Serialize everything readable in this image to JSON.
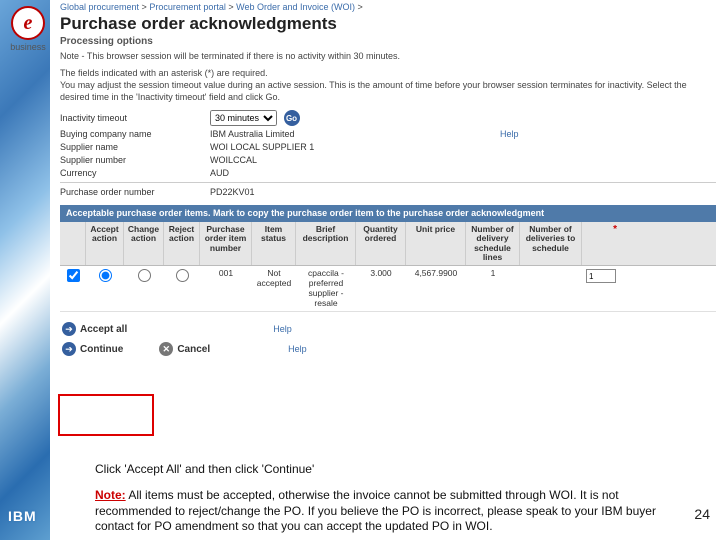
{
  "sidebar": {
    "ebiz_letter": "e",
    "ebiz_caption": "business"
  },
  "breadcrumb": {
    "p1": "Global procurement",
    "p2": "Procurement portal",
    "p3": "Web Order and Invoice (WOI)"
  },
  "page": {
    "title": "Purchase order acknowledgments",
    "subtitle": "Processing options",
    "note1": "Note - This browser session will be terminated if there is no activity within 30 minutes.",
    "note2": "The fields indicated with an asterisk (*) are required.\nYou may adjust the session timeout value during an active session. This is the amount of time before your browser session terminates for inactivity. Select the desired time in the 'Inactivity timeout' field and click Go."
  },
  "fields": {
    "timeout_label": "Inactivity timeout",
    "timeout_value": "30 minutes",
    "go": "Go",
    "help": "Help",
    "buying_label": "Buying company name",
    "buying_value": "IBM Australia Limited",
    "supplier_label": "Supplier name",
    "supplier_value": "WOI LOCAL SUPPLIER 1",
    "supnum_label": "Supplier number",
    "supnum_value": "WOILCCAL",
    "currency_label": "Currency",
    "currency_value": "AUD",
    "po_label": "Purchase order number",
    "po_value": "PD22KV01"
  },
  "table": {
    "banner": "Acceptable purchase order items. Mark to copy the purchase order item to the purchase order acknowledgment",
    "headers": {
      "accept": "Accept action",
      "change": "Change action",
      "reject": "Reject action",
      "order": "Purchase order item number",
      "status": "Item status",
      "desc": "Brief description",
      "qty": "Quantity ordered",
      "price": "Unit price",
      "ndel": "Number of delivery schedule lines",
      "nsch": "Number of deliveries to schedule"
    },
    "row": {
      "order": "001",
      "status": "Not accepted",
      "desc": "cpaccila - preferred supplier - resale",
      "qty": "3.000",
      "price": "4,567.9900",
      "ndel": "1",
      "nsch_value": "1"
    }
  },
  "actions": {
    "accept_all": "Accept all",
    "continue": "Continue",
    "cancel": "Cancel",
    "help": "Help"
  },
  "footer": {
    "instruction": "Click 'Accept All' and then click 'Continue'",
    "note_label": "Note:",
    "note_text": " All items must be accepted, otherwise the invoice cannot be submitted through WOI. It is not recommended to reject/change the PO. If you believe the PO is incorrect, please speak to your IBM buyer contact for PO amendment so that you can accept the updated PO in WOI.",
    "page": "24",
    "ibm": "IBM"
  }
}
